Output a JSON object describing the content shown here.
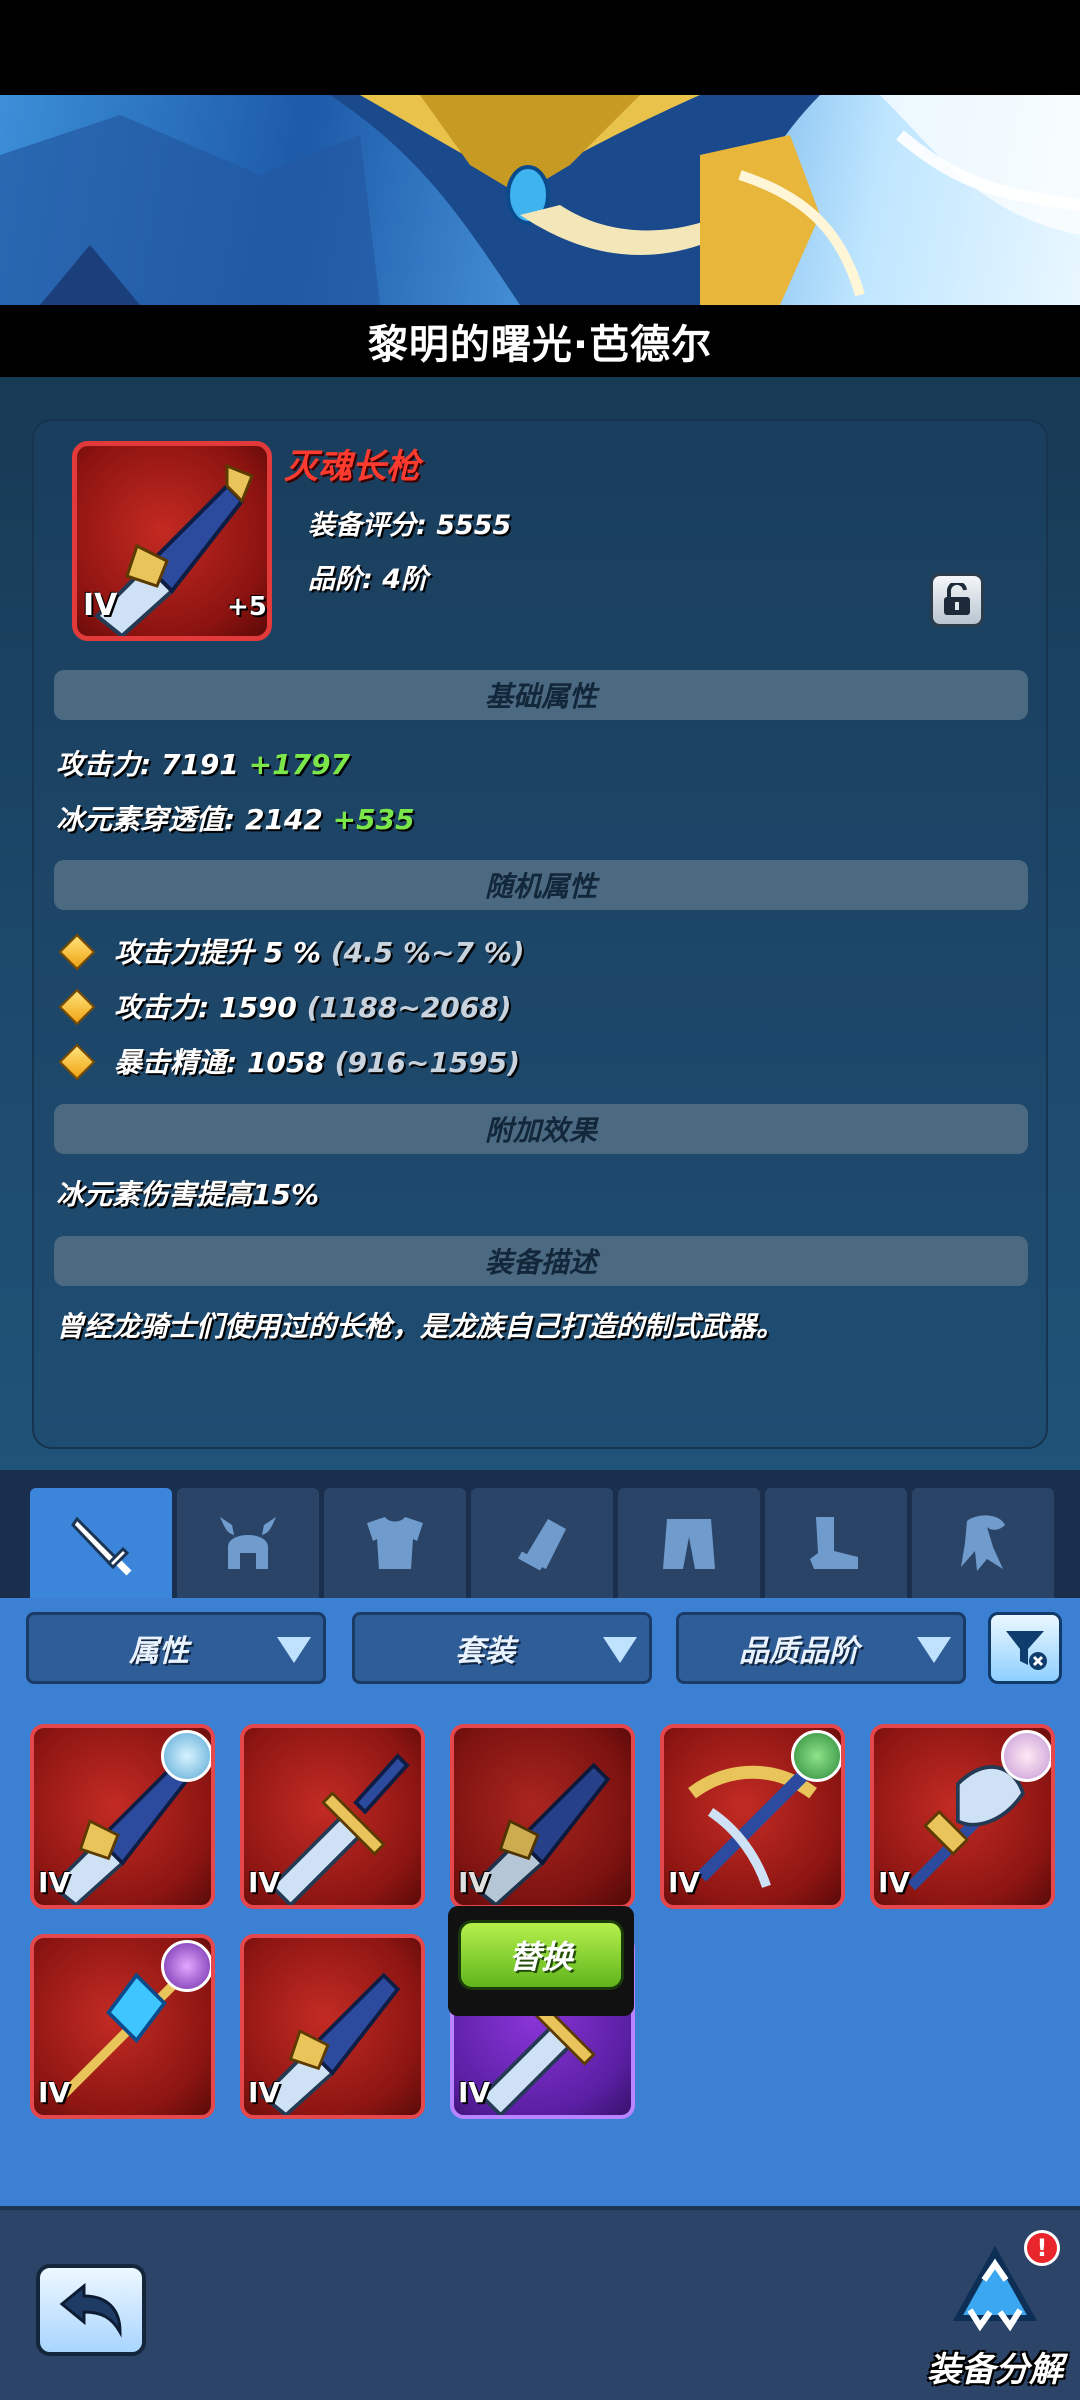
{
  "header": {
    "title": "黎明的曙光·芭德尔"
  },
  "item": {
    "name": "灭魂长枪",
    "tier": "IV",
    "enhance": "+5",
    "score_label": "装备评分: 5555",
    "grade_label": "品阶: 4阶",
    "icon": "spear-icon",
    "lock_icon": "lock-icon"
  },
  "sections": {
    "base": "基础属性",
    "random": "随机属性",
    "extra": "附加效果",
    "desc": "装备描述"
  },
  "base_stats": [
    {
      "label": "攻击力: 7191",
      "bonus": "+1797"
    },
    {
      "label": "冰元素穿透值: 2142",
      "bonus": "+535"
    }
  ],
  "random_stats": [
    {
      "label": "攻击力提升 5 %",
      "range": "(4.5 %~7 %)"
    },
    {
      "label": "攻击力: 1590",
      "range": "(1188~2068)"
    },
    {
      "label": "暴击精通: 1058",
      "range": "(916~1595)"
    }
  ],
  "extra_effect": "冰元素伤害提高15%",
  "description": "曾经龙骑士们使用过的长枪，是龙族自己打造的制式武器。",
  "tabs": [
    {
      "icon": "sword-icon",
      "active": true
    },
    {
      "icon": "helmet-icon",
      "active": false
    },
    {
      "icon": "armor-icon",
      "active": false
    },
    {
      "icon": "gauntlet-icon",
      "active": false
    },
    {
      "icon": "pants-icon",
      "active": false
    },
    {
      "icon": "boots-icon",
      "active": false
    },
    {
      "icon": "cape-icon",
      "active": false
    }
  ],
  "filters": {
    "attribute": "属性",
    "set": "套装",
    "quality": "品质品阶",
    "filter_icon": "filter-icon"
  },
  "inventory": [
    {
      "tier": "IV",
      "icon": "spear-icon",
      "quality": "red",
      "badge": "ice-badge"
    },
    {
      "tier": "IV",
      "icon": "sword-icon",
      "quality": "red",
      "badge": ""
    },
    {
      "tier": "IV",
      "icon": "spear-icon",
      "quality": "red",
      "badge": ""
    },
    {
      "tier": "IV",
      "icon": "crossbow-icon",
      "quality": "red",
      "badge": "wind-badge"
    },
    {
      "tier": "IV",
      "icon": "axe-icon",
      "quality": "red",
      "badge": "spirit-badge"
    },
    {
      "tier": "IV",
      "icon": "crystal-staff-icon",
      "quality": "red",
      "badge": "dark-badge"
    },
    {
      "tier": "IV",
      "icon": "spear-icon",
      "quality": "red",
      "badge": ""
    },
    {
      "tier": "IV",
      "icon": "sword-icon",
      "quality": "purple",
      "badge": ""
    }
  ],
  "replace_label": "替换",
  "bottom": {
    "back_icon": "back-arrow-icon",
    "salvage_label": "装备分解",
    "salvage_icon": "recycle-icon",
    "alert": "!"
  }
}
